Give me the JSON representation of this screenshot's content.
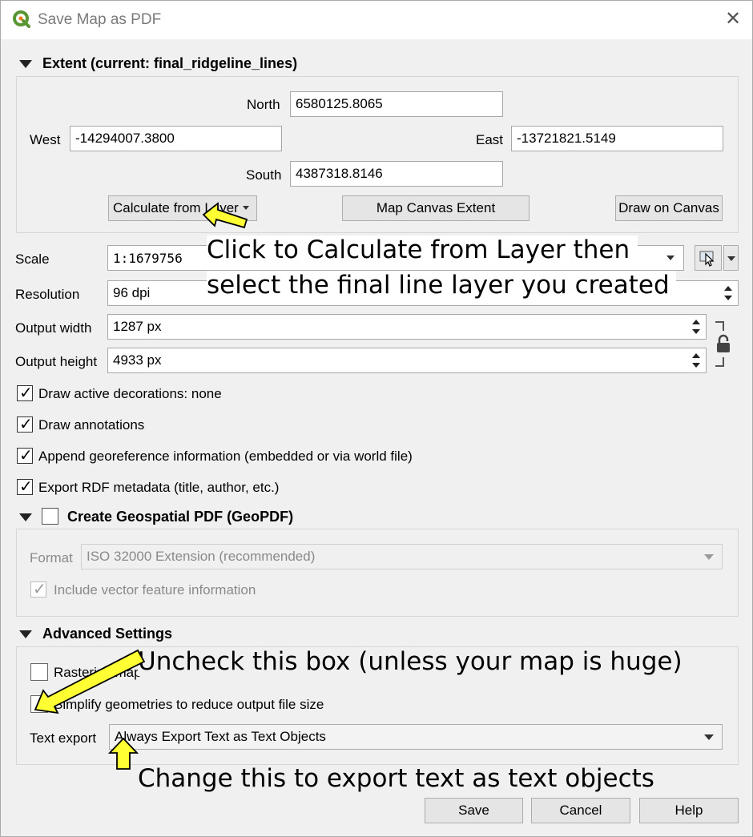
{
  "window": {
    "title": "Save Map as PDF"
  },
  "extent": {
    "header": "Extent (current: final_ridgeline_lines)",
    "north_label": "North",
    "north_value": "6580125.8065",
    "west_label": "West",
    "west_value": "-14294007.3800",
    "east_label": "East",
    "east_value": "-13721821.5149",
    "south_label": "South",
    "south_value": "4387318.8146",
    "calc_button": "Calculate from Layer",
    "canvas_button": "Map Canvas Extent",
    "draw_button": "Draw on Canvas"
  },
  "settings": {
    "scale_label": "Scale",
    "scale_value": "1:1679756",
    "resolution_label": "Resolution",
    "resolution_value": "96 dpi",
    "width_label": "Output width",
    "width_value": "1287 px",
    "height_label": "Output height",
    "height_value": "4933 px"
  },
  "options": {
    "decorations": "Draw active decorations: none",
    "annotations": "Draw annotations",
    "georef": "Append georeference information (embedded or via world file)",
    "rdf": "Export RDF metadata (title, author, etc.)"
  },
  "geopdf": {
    "header": "Create Geospatial PDF (GeoPDF)",
    "format_label": "Format",
    "format_value": "ISO 32000 Extension (recommended)",
    "include_vector": "Include vector feature information"
  },
  "advanced": {
    "header": "Advanced Settings",
    "rasterize": "Rasterize map",
    "simplify": "Simplify geometries to reduce output file size",
    "text_export_label": "Text export",
    "text_export_value": "Always Export Text as Text Objects"
  },
  "buttons": {
    "save": "Save",
    "cancel": "Cancel",
    "help": "Help"
  },
  "annotations": {
    "calc_line1": "Click to Calculate from Layer then",
    "calc_line2": "select the final line layer you created",
    "uncheck": "Uncheck this box (unless your map is huge)",
    "text_objects": "Change this to export text as text objects"
  },
  "colors": {
    "arrow_fill": "#ffff33",
    "arrow_stroke": "#000000",
    "qgis_green": "#589632"
  }
}
